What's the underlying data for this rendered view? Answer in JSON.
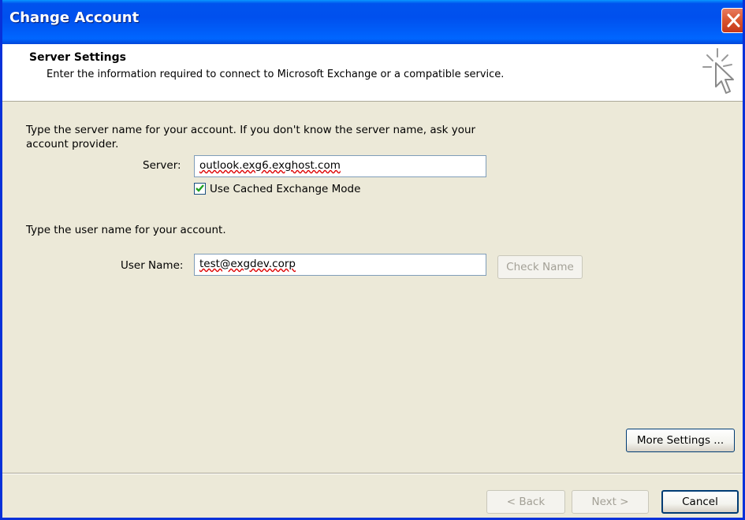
{
  "window": {
    "title": "Change Account"
  },
  "header": {
    "title": "Server Settings",
    "subtitle": "Enter the information required to connect to Microsoft Exchange or a compatible service."
  },
  "server_section": {
    "instructions_line1": "Type the server name for your account. If you don't know the server name, ask your",
    "instructions_line2": "account provider.",
    "server_label": "Server:",
    "server_value": "outlook.exg6.exghost.com",
    "cached_mode_label": "Use Cached Exchange Mode",
    "cached_mode_checked": true
  },
  "user_section": {
    "instructions": "Type the user name for your account.",
    "username_label": "User Name:",
    "username_value": "test@exgdev.corp",
    "check_name_label": "Check Name"
  },
  "buttons": {
    "more_settings": "More Settings ...",
    "back": "< Back",
    "next": "Next >",
    "cancel": "Cancel"
  },
  "colors": {
    "titlebar": "#0054e3",
    "dialog_bg": "#ece9d8",
    "close_button": "#d9542d"
  },
  "icons": {
    "close": "close-icon",
    "wizard": "wizard-cursor-icon",
    "checkmark": "checkmark-icon"
  }
}
